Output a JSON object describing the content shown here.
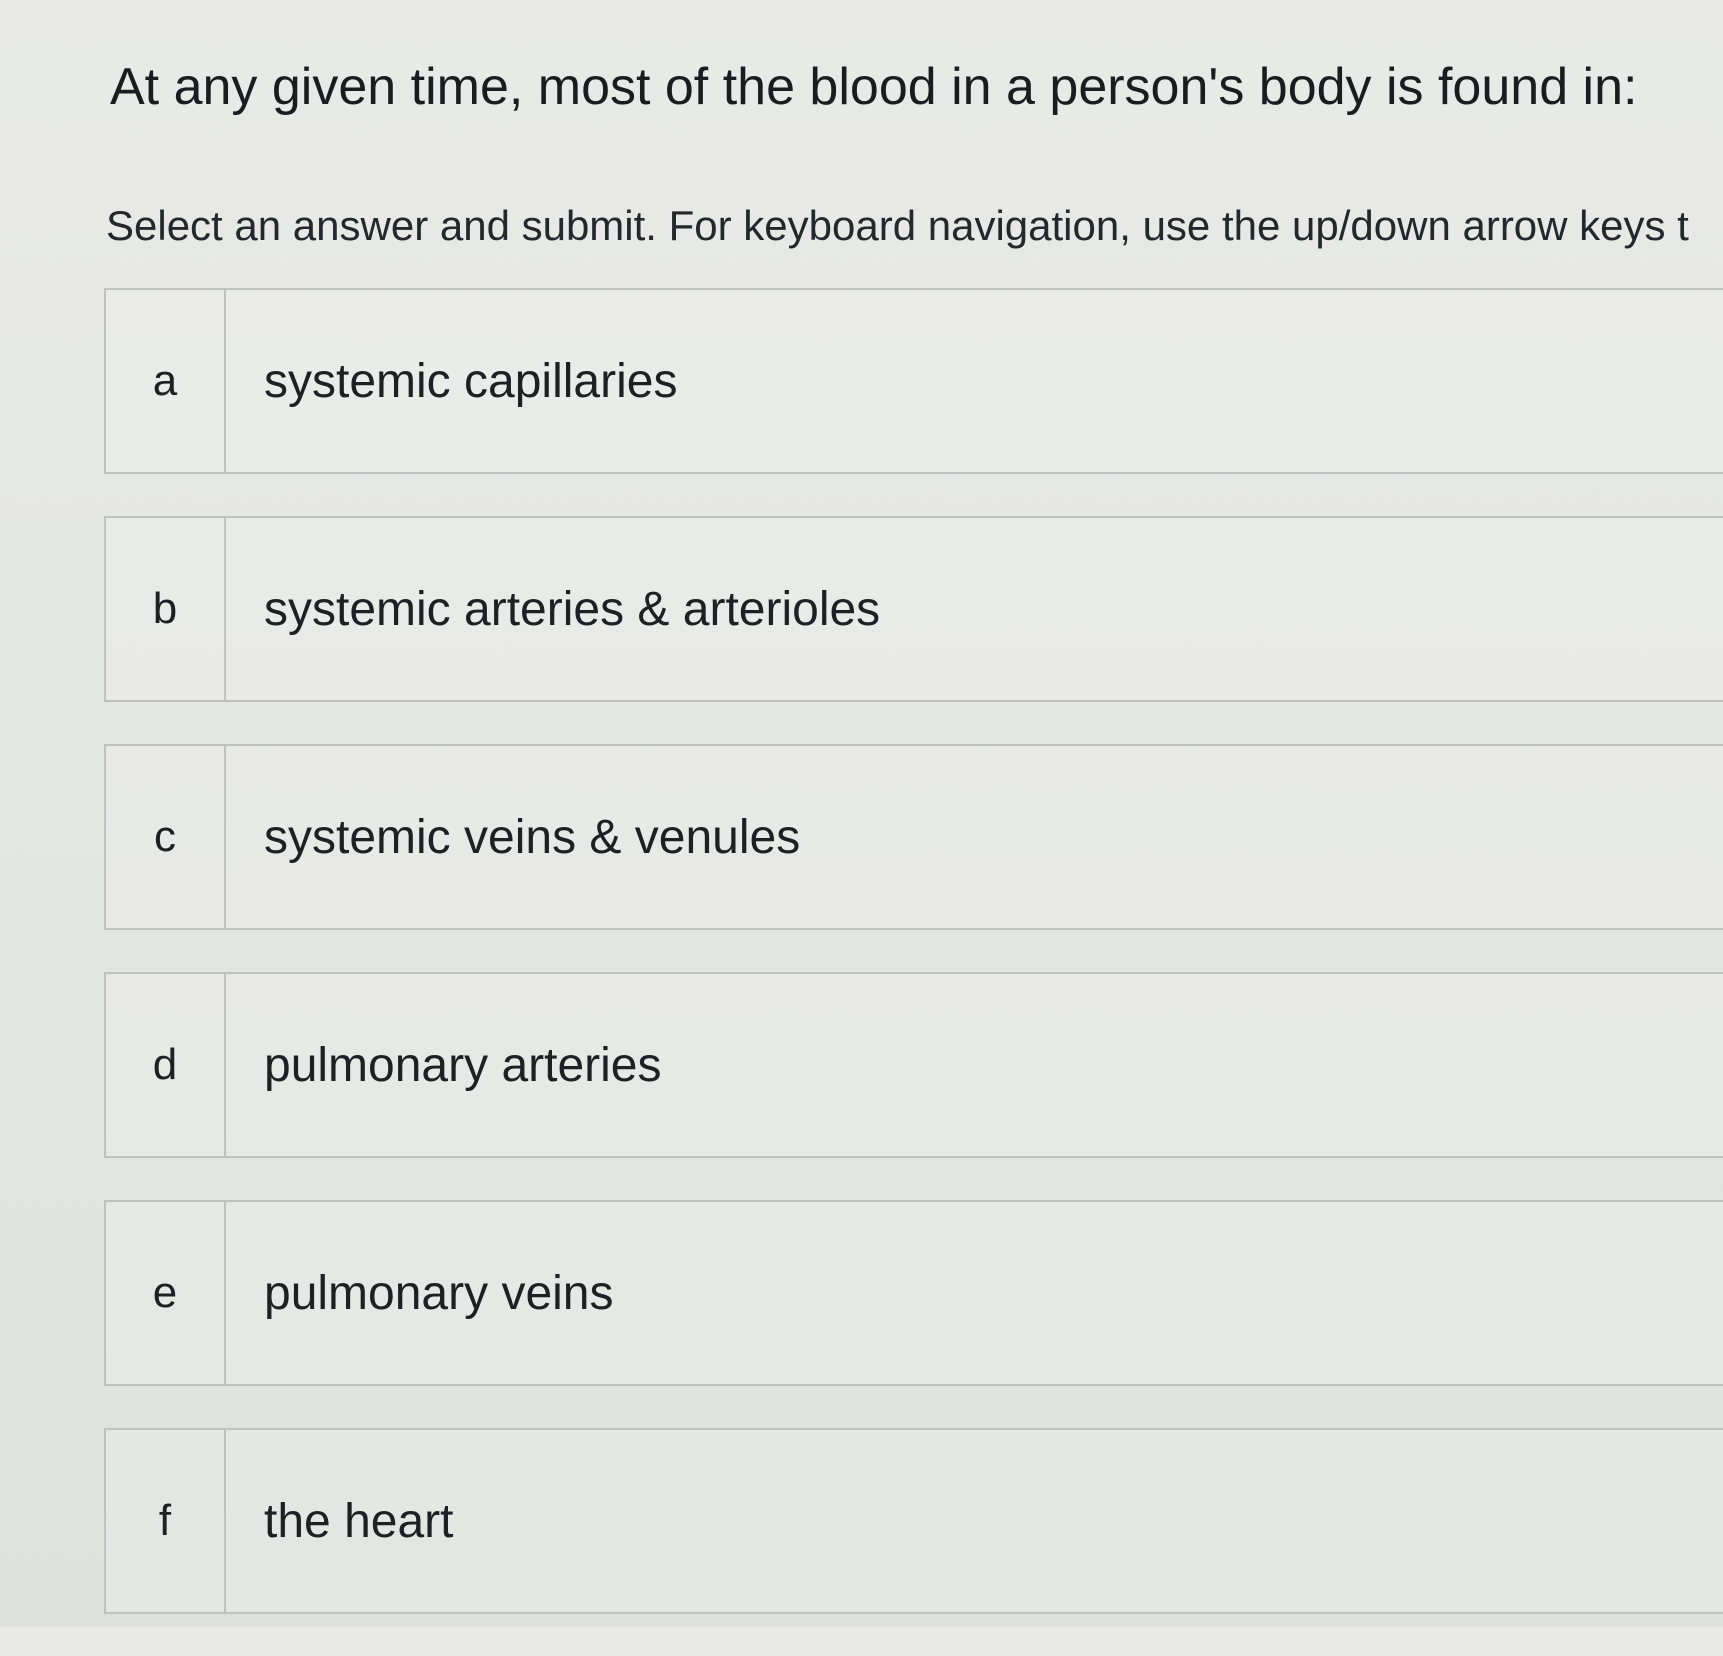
{
  "question": {
    "text": "At any given time, most of the blood in a person's body is found in:"
  },
  "instructions": {
    "text": "Select an answer and submit. For keyboard navigation, use the up/down arrow keys t"
  },
  "choices": [
    {
      "letter": "a",
      "text": "systemic capillaries"
    },
    {
      "letter": "b",
      "text": "systemic arteries & arterioles"
    },
    {
      "letter": "c",
      "text": "systemic veins & venules"
    },
    {
      "letter": "d",
      "text": "pulmonary arteries"
    },
    {
      "letter": "e",
      "text": "pulmonary veins"
    },
    {
      "letter": "f",
      "text": "the heart"
    }
  ]
}
